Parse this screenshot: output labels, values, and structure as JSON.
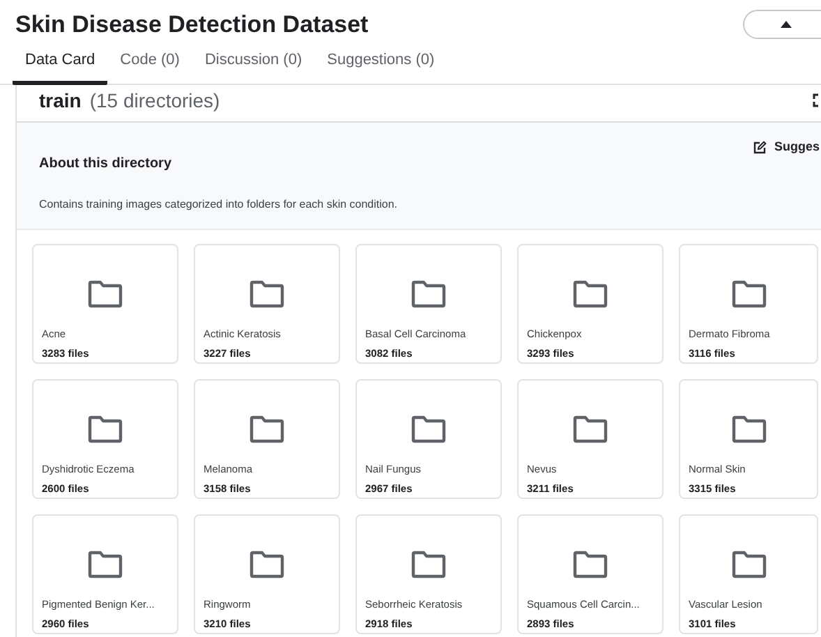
{
  "title": "Skin Disease Detection Dataset",
  "tabs": [
    {
      "label": "Data Card",
      "selected": true
    },
    {
      "label": "Code (0)",
      "selected": false
    },
    {
      "label": "Discussion (0)",
      "selected": false
    },
    {
      "label": "Suggestions (0)",
      "selected": false
    }
  ],
  "directory": {
    "name": "train",
    "count": "(15 directories)"
  },
  "about": {
    "heading": "About this directory",
    "description": "Contains training images categorized into folders for each skin condition.",
    "suggest_label": "Sugges"
  },
  "folders": [
    {
      "name": "Acne",
      "files": "3283 files"
    },
    {
      "name": "Actinic Keratosis",
      "files": "3227 files"
    },
    {
      "name": "Basal Cell Carcinoma",
      "files": "3082 files"
    },
    {
      "name": "Chickenpox",
      "files": "3293 files"
    },
    {
      "name": "Dermato Fibroma",
      "files": "3116 files"
    },
    {
      "name": "Dyshidrotic Eczema",
      "files": "2600 files"
    },
    {
      "name": "Melanoma",
      "files": "3158 files"
    },
    {
      "name": "Nail Fungus",
      "files": "2967 files"
    },
    {
      "name": "Nevus",
      "files": "3211 files"
    },
    {
      "name": "Normal Skin",
      "files": "3315 files"
    },
    {
      "name": "Pigmented Benign Ker...",
      "files": "2960 files"
    },
    {
      "name": "Ringworm",
      "files": "3210 files"
    },
    {
      "name": "Seborrheic Keratosis",
      "files": "2918 files"
    },
    {
      "name": "Squamous Cell Carcin...",
      "files": "2893 files"
    },
    {
      "name": "Vascular Lesion",
      "files": "3101 files"
    }
  ]
}
